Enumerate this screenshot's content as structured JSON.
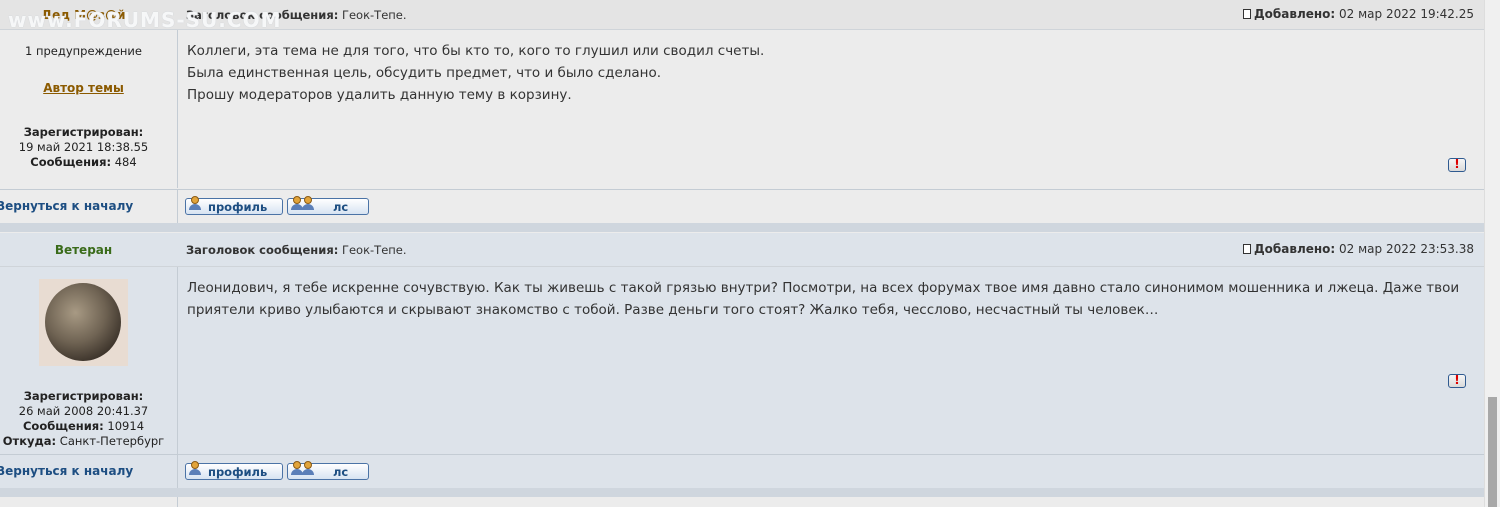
{
  "watermark": "www.FORUMS-SU.COM",
  "subject_label": "Заголовок сообщения:",
  "added_label": "Добавлено:",
  "back_to_top": "Вернуться к началу",
  "buttons": {
    "profile": "профиль",
    "pm": "лс"
  },
  "posts": [
    {
      "author": "Дед М@з@й",
      "warnings": "1 предупреждение",
      "topic_author": "Автор темы",
      "registered_label": "Зарегистрирован:",
      "registered": "19 май 2021 18:38.55",
      "messages_label": "Сообщения:",
      "messages": "484",
      "subject": "Геок-Тепе.",
      "added": "02 мар 2022 19:42.25",
      "lines": [
        "Коллеги, эта тема не для того, что бы кто то, кого то глушил или сводил счеты.",
        "Была единственная цель, обсудить предмет, что и было сделано.",
        "Прошу модераторов удалить данную тему в корзину."
      ]
    },
    {
      "author": "Ветеран",
      "registered_label": "Зарегистрирован:",
      "registered": "26 май 2008 20:41.37",
      "messages_label": "Сообщения:",
      "messages": "10914",
      "from_label": "Откуда:",
      "from": "Санкт-Петербург",
      "subject": "Геок-Тепе.",
      "added": "02 мар 2022 23:53.38",
      "lines": [
        "Леонидович, я тебе искренне сочувствую. Как ты живешь с такой грязью внутри? Посмотри, на всех форумах твое имя давно стало синонимом мошенника и лжеца. Даже твои",
        "приятели криво улыбаются и скрывают знакомство с тобой. Разве деньги того стоят? Жалко тебя, чесслово, несчастный ты человек…"
      ]
    }
  ],
  "colors": {
    "author1": "#8b5a00",
    "author2": "#3a6b1a",
    "link": "#1d4e82"
  }
}
